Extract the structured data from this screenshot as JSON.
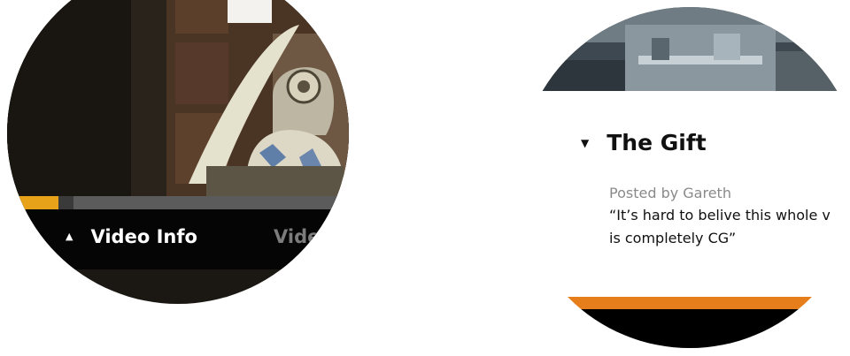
{
  "left_watch": {
    "progress_fraction": 0.15,
    "tabs": {
      "video_info_label": "Video Info",
      "videos_label": "Videos"
    },
    "colors": {
      "progress": "#e8a21a",
      "bar": "#050505"
    }
  },
  "right_watch": {
    "post": {
      "title": "The Gift",
      "byline": "Posted by Gareth",
      "quote": "“It’s hard to belive this whole v\nis completely CG”"
    },
    "colors": {
      "accent": "#e67e1c"
    }
  }
}
